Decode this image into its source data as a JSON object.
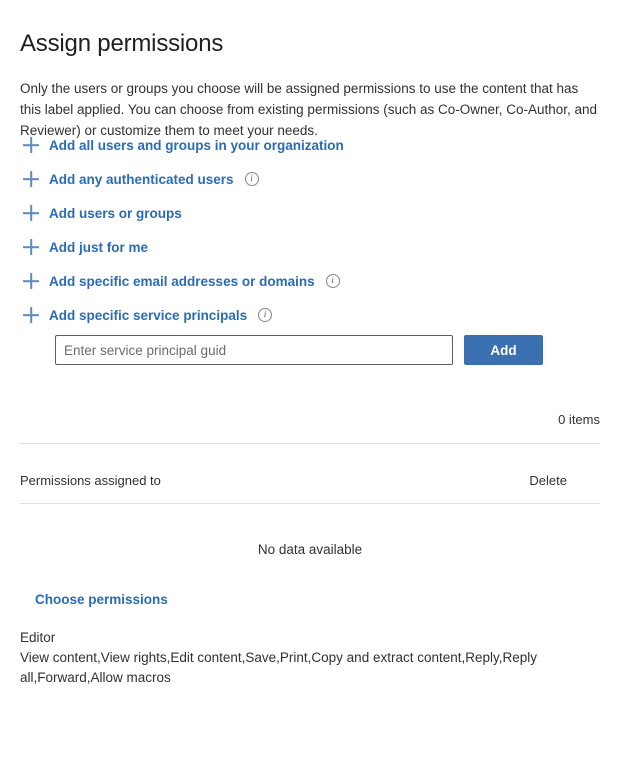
{
  "page": {
    "title": "Assign permissions",
    "description": "Only the users or groups you choose will be assigned permissions to use the content that has this label applied. You can choose from existing permissions (such as Co-Owner, Co-Author, and Reviewer) or customize them to meet your needs."
  },
  "colors": {
    "link_blue": "#2a6bb5",
    "plus_blue": "#5b8bc4",
    "button_blue": "#3a6fb0",
    "text_dark": "#323130",
    "title_dark": "#201f1e",
    "divider": "#e1dfdd",
    "input_border": "#605e5c",
    "info_icon_gray": "#8a8886"
  },
  "add_options": [
    {
      "label": "Add all users and groups in your organization",
      "icon": "plus-icon",
      "has_info": false,
      "info_icon": "info-icon"
    },
    {
      "label": "Add any authenticated users",
      "icon": "plus-icon",
      "has_info": true,
      "info_icon": "info-icon"
    },
    {
      "label": "Add users or groups",
      "icon": "plus-icon",
      "has_info": false,
      "info_icon": "info-icon"
    },
    {
      "label": "Add just for me",
      "icon": "plus-icon",
      "has_info": false,
      "info_icon": "info-icon"
    },
    {
      "label": "Add specific email addresses or domains",
      "icon": "plus-icon",
      "has_info": true,
      "info_icon": "info-icon"
    },
    {
      "label": "Add specific service principals",
      "icon": "plus-icon",
      "has_info": true,
      "info_icon": "info-icon"
    }
  ],
  "service_principal_form": {
    "input_placeholder": "Enter service principal guid",
    "input_value": "",
    "add_button_label": "Add"
  },
  "table": {
    "items_count_label": "0 items",
    "columns": [
      {
        "label": "Permissions assigned to"
      },
      {
        "label": "Delete"
      }
    ],
    "rows": [],
    "empty_message": "No data available"
  },
  "permissions": {
    "choose_link_label": "Choose permissions",
    "role": "Editor",
    "rights": "View content,View rights,Edit content,Save,Print,Copy and extract content,Reply,Reply all,Forward,Allow macros",
    "rights_list": [
      "View content",
      "View rights",
      "Edit content",
      "Save",
      "Print",
      "Copy and extract content",
      "Reply",
      "Reply all",
      "Forward",
      "Allow macros"
    ]
  },
  "info_glyph": "i"
}
